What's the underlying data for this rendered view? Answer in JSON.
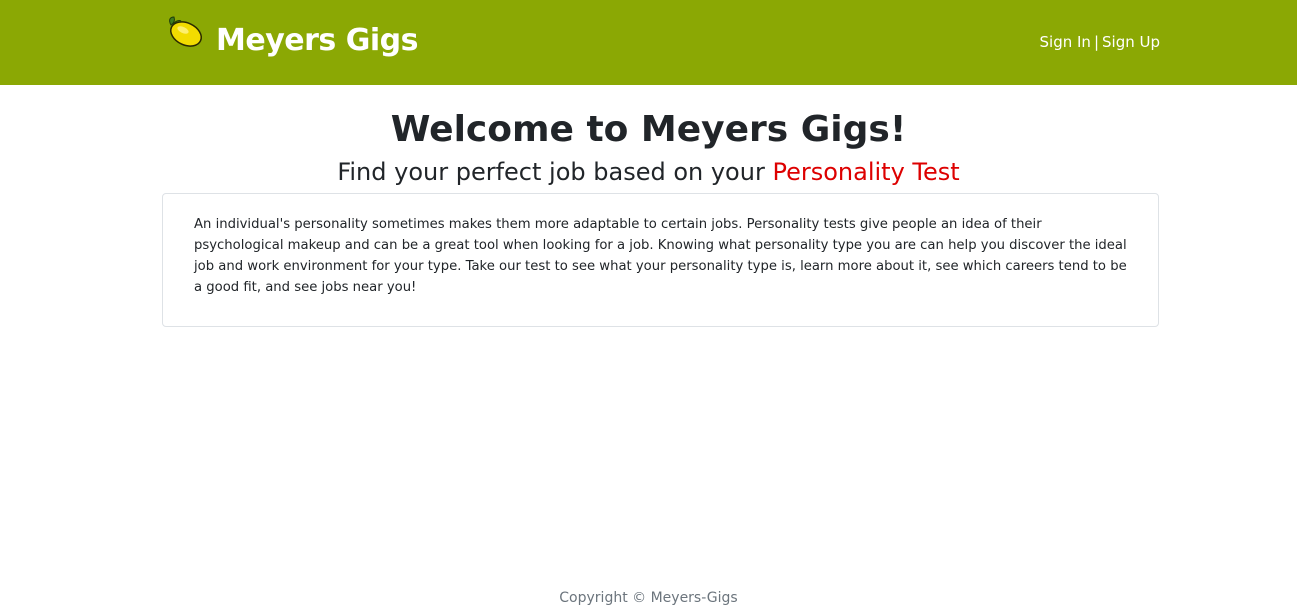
{
  "header": {
    "brand_name": "Meyers Gigs",
    "logo_icon": "lemon-icon",
    "sign_in_label": "Sign In",
    "separator": "|",
    "sign_up_label": "Sign Up",
    "background_color": "#8ba804"
  },
  "main": {
    "title": "Welcome to Meyers Gigs!",
    "subtitle_prefix": "Find your perfect job based on your",
    "subtitle_highlight": "Personality Test",
    "highlight_color": "#dd0000",
    "intro_text": "An individual's personality sometimes makes them more adaptable to certain jobs. Personality tests give people an idea of their psychological makeup and can be a great tool when looking for a job. Knowing what personality type you are can help you discover the ideal job and work environment for your type. Take our test to see what your personality type is, learn more about it, see which careers tend to be a good fit, and see jobs near you!"
  },
  "footer": {
    "copyright": "Copyright © Meyers-Gigs"
  }
}
